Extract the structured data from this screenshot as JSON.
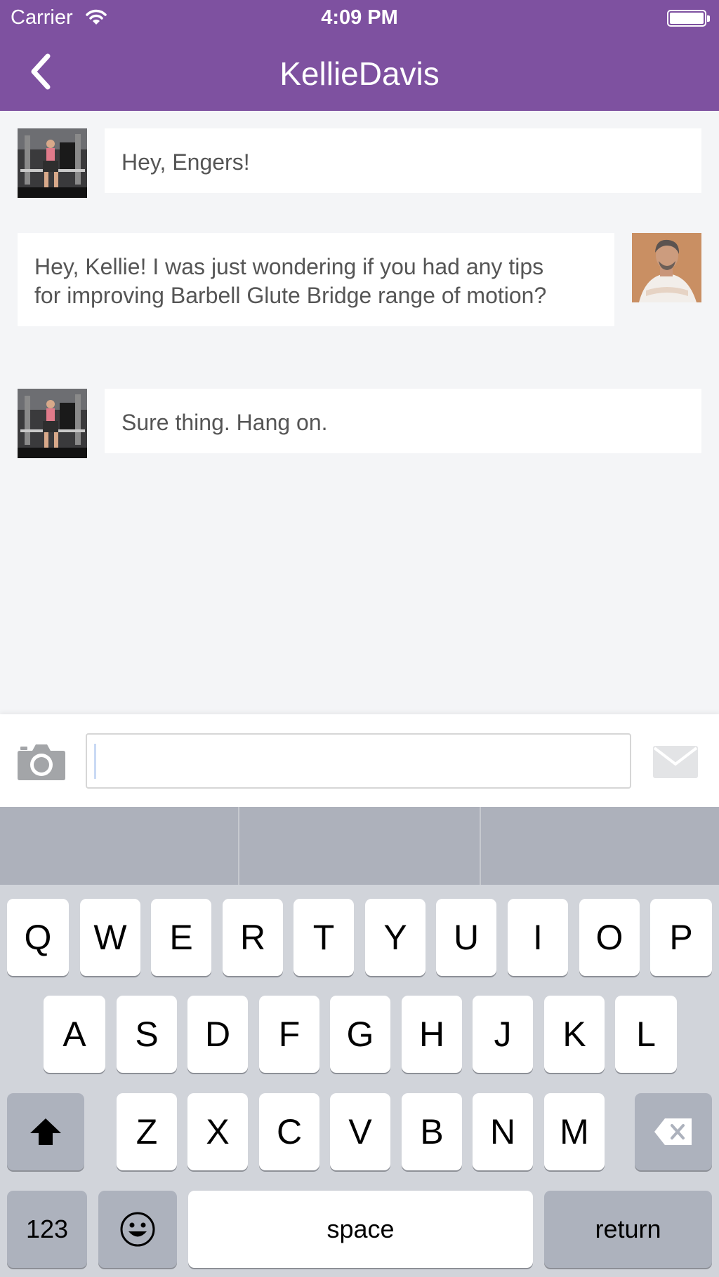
{
  "status_bar": {
    "carrier": "Carrier",
    "time": "4:09 PM"
  },
  "nav": {
    "title": "KellieDavis"
  },
  "messages": [
    {
      "from": "KellieDavis",
      "text": "Hey, Engers!"
    },
    {
      "from": "self",
      "line1": "Hey, Kellie! I was just wondering if you had any tips",
      "line2": "for improving Barbell Glute Bridge range of motion?"
    },
    {
      "from": "KellieDavis",
      "text": "Sure thing. Hang on."
    }
  ],
  "composer": {
    "value": "",
    "placeholder": ""
  },
  "keyboard": {
    "row1": [
      "Q",
      "W",
      "E",
      "R",
      "T",
      "Y",
      "U",
      "I",
      "O",
      "P"
    ],
    "row2": [
      "A",
      "S",
      "D",
      "F",
      "G",
      "H",
      "J",
      "K",
      "L"
    ],
    "row3": [
      "Z",
      "X",
      "C",
      "V",
      "B",
      "N",
      "M"
    ],
    "numbers_label": "123",
    "space_label": "space",
    "return_label": "return"
  },
  "colors": {
    "header": "#7e51a0",
    "background": "#f4f5f7"
  },
  "icons": [
    "wifi-icon",
    "battery-icon",
    "back-chevron-icon",
    "camera-icon",
    "envelope-icon",
    "shift-icon",
    "backspace-icon",
    "emoji-icon"
  ]
}
